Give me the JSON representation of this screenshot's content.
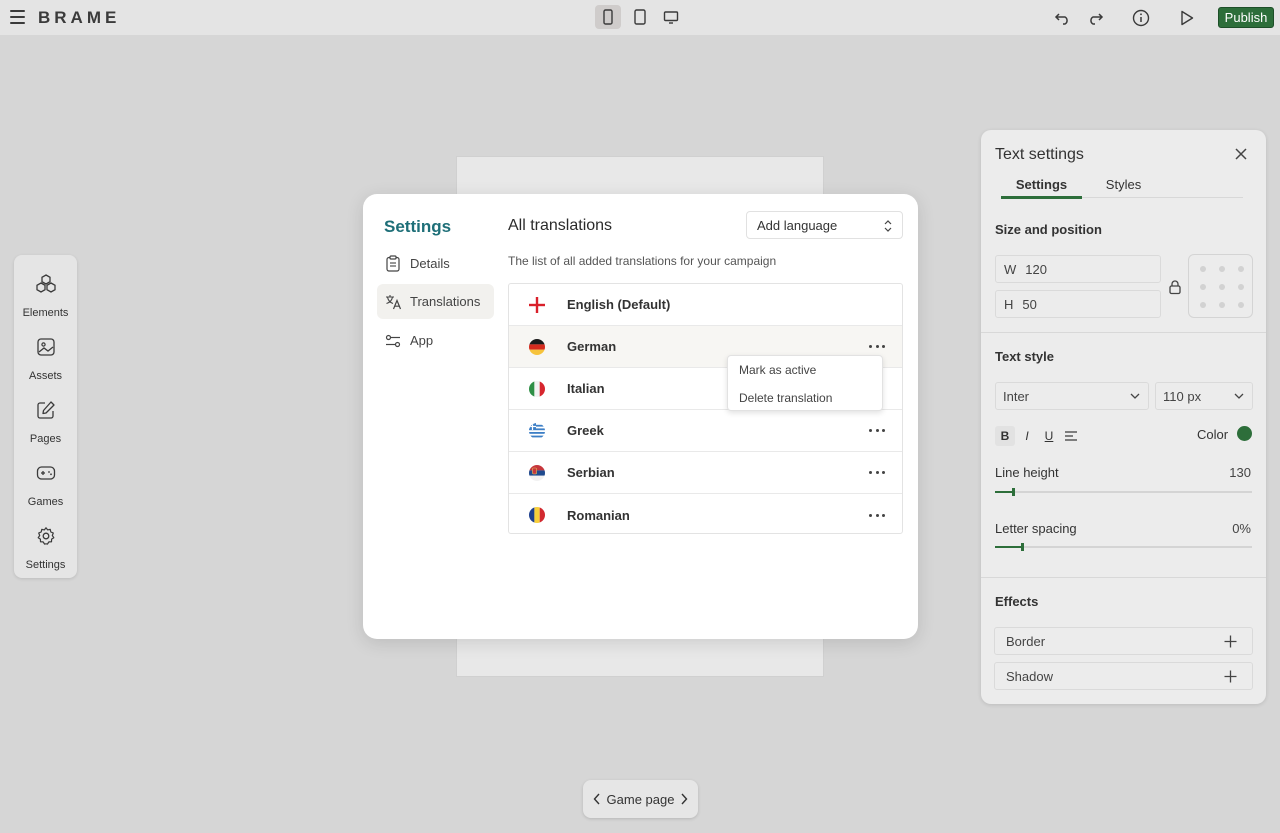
{
  "app": {
    "logo": "BRAME",
    "publish_label": "Publish"
  },
  "rail": {
    "items": [
      {
        "label": "Elements",
        "icon": "elements-icon"
      },
      {
        "label": "Assets",
        "icon": "image-icon"
      },
      {
        "label": "Pages",
        "icon": "edit-icon"
      },
      {
        "label": "Games",
        "icon": "gamepad-icon"
      },
      {
        "label": "Settings",
        "icon": "gear-icon"
      }
    ]
  },
  "modal": {
    "title": "Settings",
    "nav": [
      {
        "label": "Details",
        "icon": "clipboard-icon"
      },
      {
        "label": "Translations",
        "icon": "translate-icon"
      },
      {
        "label": "App",
        "icon": "sliders-icon"
      }
    ],
    "section_title": "All translations",
    "add_language": "Add language",
    "subtitle": "The list of all added translations for your campaign",
    "languages": [
      {
        "name": "English (Default)"
      },
      {
        "name": "German"
      },
      {
        "name": "Italian"
      },
      {
        "name": "Greek"
      },
      {
        "name": "Serbian"
      },
      {
        "name": "Romanian"
      }
    ],
    "context_menu": [
      "Mark as active",
      "Delete translation"
    ]
  },
  "panel": {
    "title": "Text settings",
    "tabs": [
      "Settings",
      "Styles"
    ],
    "size_heading": "Size and position",
    "width_label": "W",
    "width_value": "120",
    "height_label": "H",
    "height_value": "50",
    "text_style_heading": "Text style",
    "font": "Inter",
    "font_size": "110 px",
    "format": {
      "bold": "B",
      "italic": "I",
      "underline": "U"
    },
    "color_label": "Color",
    "color_value": "#2d6e3a",
    "line_height_label": "Line height",
    "line_height_value": "130",
    "letter_spacing_label": "Letter spacing",
    "letter_spacing_value": "0%",
    "effects_heading": "Effects",
    "effects": [
      "Border",
      "Shadow"
    ]
  },
  "page_switch": {
    "label": "Game page"
  },
  "colors": {
    "accent": "#2d6e3a",
    "title": "#1e6f78"
  }
}
